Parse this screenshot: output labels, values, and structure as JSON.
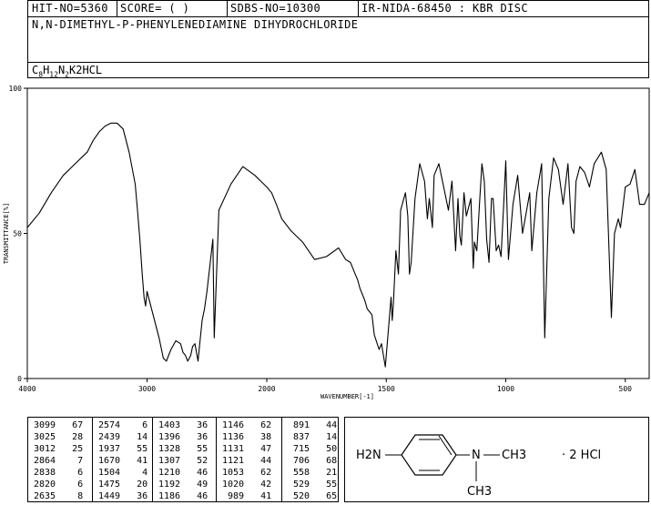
{
  "header": {
    "hit_no": "HIT-NO=5360",
    "score": "SCORE=  (   )",
    "sdbs_no": "SDBS-NO=10300",
    "ir_code": "IR-NIDA-68450 : KBR DISC",
    "compound_name": "N,N-DIMETHYL-P-PHENYLENEDIAMINE DIHYDROCHLORIDE",
    "formula_parts": [
      "C",
      "8",
      "H",
      "12",
      "N",
      "2",
      "K2HCL"
    ]
  },
  "chart_data": {
    "type": "line",
    "xlabel": "WAVENUMBER[-1]",
    "ylabel": "TRANSMITTANCE[%]",
    "xlim": [
      4000,
      400
    ],
    "ylim": [
      0,
      100
    ],
    "x_ticks": [
      4000,
      3000,
      2000,
      1500,
      1000,
      500
    ],
    "y_ticks": [
      0,
      50,
      100
    ],
    "grid": false,
    "series": [
      {
        "x": [
          4000,
          3900,
          3800,
          3700,
          3600,
          3500,
          3450,
          3400,
          3350,
          3300,
          3250,
          3200,
          3150,
          3099,
          3080,
          3060,
          3040,
          3025,
          3012,
          3000,
          2950,
          2900,
          2864,
          2838,
          2820,
          2800,
          2760,
          2720,
          2700,
          2680,
          2660,
          2635,
          2620,
          2600,
          2574,
          2560,
          2540,
          2520,
          2500,
          2450,
          2439,
          2400,
          2300,
          2200,
          2100,
          2050,
          2000,
          1980,
          1960,
          1937,
          1900,
          1850,
          1800,
          1750,
          1700,
          1670,
          1650,
          1640,
          1630,
          1620,
          1610,
          1600,
          1590,
          1580,
          1570,
          1560,
          1550,
          1530,
          1520,
          1504,
          1490,
          1480,
          1475,
          1470,
          1460,
          1449,
          1440,
          1420,
          1410,
          1403,
          1396,
          1380,
          1360,
          1340,
          1328,
          1320,
          1307,
          1300,
          1280,
          1260,
          1240,
          1225,
          1210,
          1200,
          1192,
          1186,
          1175,
          1165,
          1146,
          1136,
          1131,
          1121,
          1110,
          1100,
          1090,
          1080,
          1070,
          1060,
          1053,
          1040,
          1030,
          1020,
          1010,
          1000,
          989,
          970,
          950,
          930,
          900,
          891,
          870,
          850,
          837,
          820,
          800,
          780,
          760,
          740,
          725,
          715,
          706,
          690,
          670,
          650,
          630,
          600,
          580,
          558,
          545,
          529,
          520,
          500,
          480,
          460,
          440,
          420,
          400
        ],
        "y": [
          52,
          57,
          64,
          70,
          74,
          78,
          82,
          85,
          87,
          88,
          88,
          86,
          78,
          67,
          58,
          48,
          36,
          28,
          25,
          30,
          22,
          14,
          7,
          6,
          8,
          10,
          13,
          12,
          9,
          8,
          6,
          8,
          11,
          12,
          6,
          12,
          20,
          24,
          30,
          48,
          14,
          58,
          67,
          73,
          70,
          68,
          66,
          64,
          60,
          55,
          51,
          47,
          41,
          42,
          45,
          41,
          40,
          38,
          36,
          34,
          31,
          29,
          27,
          24,
          23,
          22,
          15,
          10,
          12,
          4,
          18,
          28,
          20,
          26,
          44,
          36,
          58,
          64,
          56,
          36,
          40,
          62,
          74,
          68,
          55,
          62,
          52,
          70,
          74,
          66,
          58,
          68,
          44,
          62,
          49,
          46,
          64,
          56,
          62,
          38,
          47,
          44,
          60,
          74,
          68,
          48,
          40,
          62,
          62,
          44,
          46,
          42,
          58,
          75,
          41,
          60,
          70,
          50,
          64,
          44,
          64,
          74,
          14,
          62,
          76,
          72,
          60,
          74,
          52,
          50,
          68,
          73,
          71,
          66,
          74,
          78,
          72,
          21,
          50,
          55,
          52,
          66,
          67,
          72,
          60,
          60,
          64
        ]
      }
    ]
  },
  "peak_table": [
    [
      [
        3099,
        67
      ],
      [
        3025,
        28
      ],
      [
        3012,
        25
      ],
      [
        2864,
        7
      ],
      [
        2838,
        6
      ],
      [
        2820,
        6
      ],
      [
        2635,
        8
      ]
    ],
    [
      [
        2574,
        6
      ],
      [
        2439,
        14
      ],
      [
        1937,
        55
      ],
      [
        1670,
        41
      ],
      [
        1504,
        4
      ],
      [
        1475,
        20
      ],
      [
        1449,
        36
      ]
    ],
    [
      [
        1403,
        36
      ],
      [
        1396,
        36
      ],
      [
        1328,
        55
      ],
      [
        1307,
        52
      ],
      [
        1210,
        46
      ],
      [
        1192,
        49
      ],
      [
        1186,
        46
      ]
    ],
    [
      [
        1146,
        62
      ],
      [
        1136,
        38
      ],
      [
        1131,
        47
      ],
      [
        1121,
        44
      ],
      [
        1053,
        62
      ],
      [
        1020,
        42
      ],
      [
        989,
        41
      ]
    ],
    [
      [
        891,
        44
      ],
      [
        837,
        14
      ],
      [
        715,
        50
      ],
      [
        706,
        68
      ],
      [
        558,
        21
      ],
      [
        529,
        55
      ],
      [
        520,
        65
      ]
    ]
  ],
  "structure": {
    "left_group": "H2N",
    "methyl_top": "CH3",
    "methyl_bottom": "CH3",
    "nitrogen": "N",
    "salt": "·   2 HCl"
  }
}
